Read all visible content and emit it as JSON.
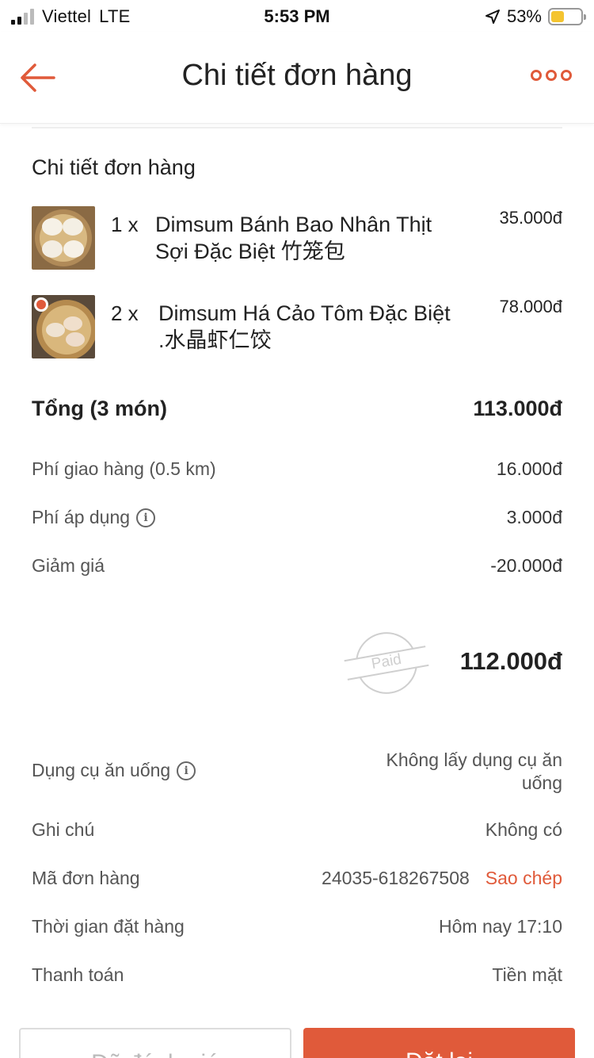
{
  "status_bar": {
    "carrier": "Viettel",
    "network": "LTE",
    "time": "5:53 PM",
    "battery": "53%"
  },
  "header": {
    "title": "Chi tiết đơn hàng"
  },
  "order": {
    "section_title": "Chi tiết đơn hàng",
    "items": [
      {
        "qty": "1 x",
        "name": "Dimsum Bánh Bao Nhân Thịt Sợi Đặc Biệt 竹笼包",
        "price": "35.000đ"
      },
      {
        "qty": "2 x",
        "name": "Dimsum Há Cảo Tôm Đặc Biệt .水晶虾仁饺",
        "price": "78.000đ"
      }
    ],
    "subtotal_label": "Tổng (3 món)",
    "subtotal_value": "113.000đ",
    "fees": [
      {
        "label": "Phí giao hàng (0.5 km)",
        "value": "16.000đ"
      },
      {
        "label": "Phí áp dụng",
        "value": "3.000đ"
      },
      {
        "label": "Giảm giá",
        "value": "-20.000đ"
      }
    ],
    "paid_stamp": "Paid",
    "grand_total": "112.000đ"
  },
  "details": {
    "utensils_label": "Dụng cụ ăn uống",
    "utensils_value": "Không lấy dụng cụ ăn uống",
    "note_label": "Ghi chú",
    "note_value": "Không có",
    "order_id_label": "Mã đơn hàng",
    "order_id_value": "24035-618267508",
    "copy_label": "Sao chép",
    "time_label": "Thời gian đặt hàng",
    "time_value": "Hôm nay 17:10",
    "payment_label": "Thanh toán",
    "payment_value": "Tiền mặt"
  },
  "actions": {
    "rated_label": "Đã đánh giá",
    "reorder_label": "Đặt lại"
  },
  "colors": {
    "accent": "#e05a3a",
    "battery": "#f4c430"
  },
  "icons": [
    "back-arrow-icon",
    "more-options-icon",
    "info-icon",
    "location-arrow-icon",
    "battery-icon",
    "signal-icon"
  ]
}
